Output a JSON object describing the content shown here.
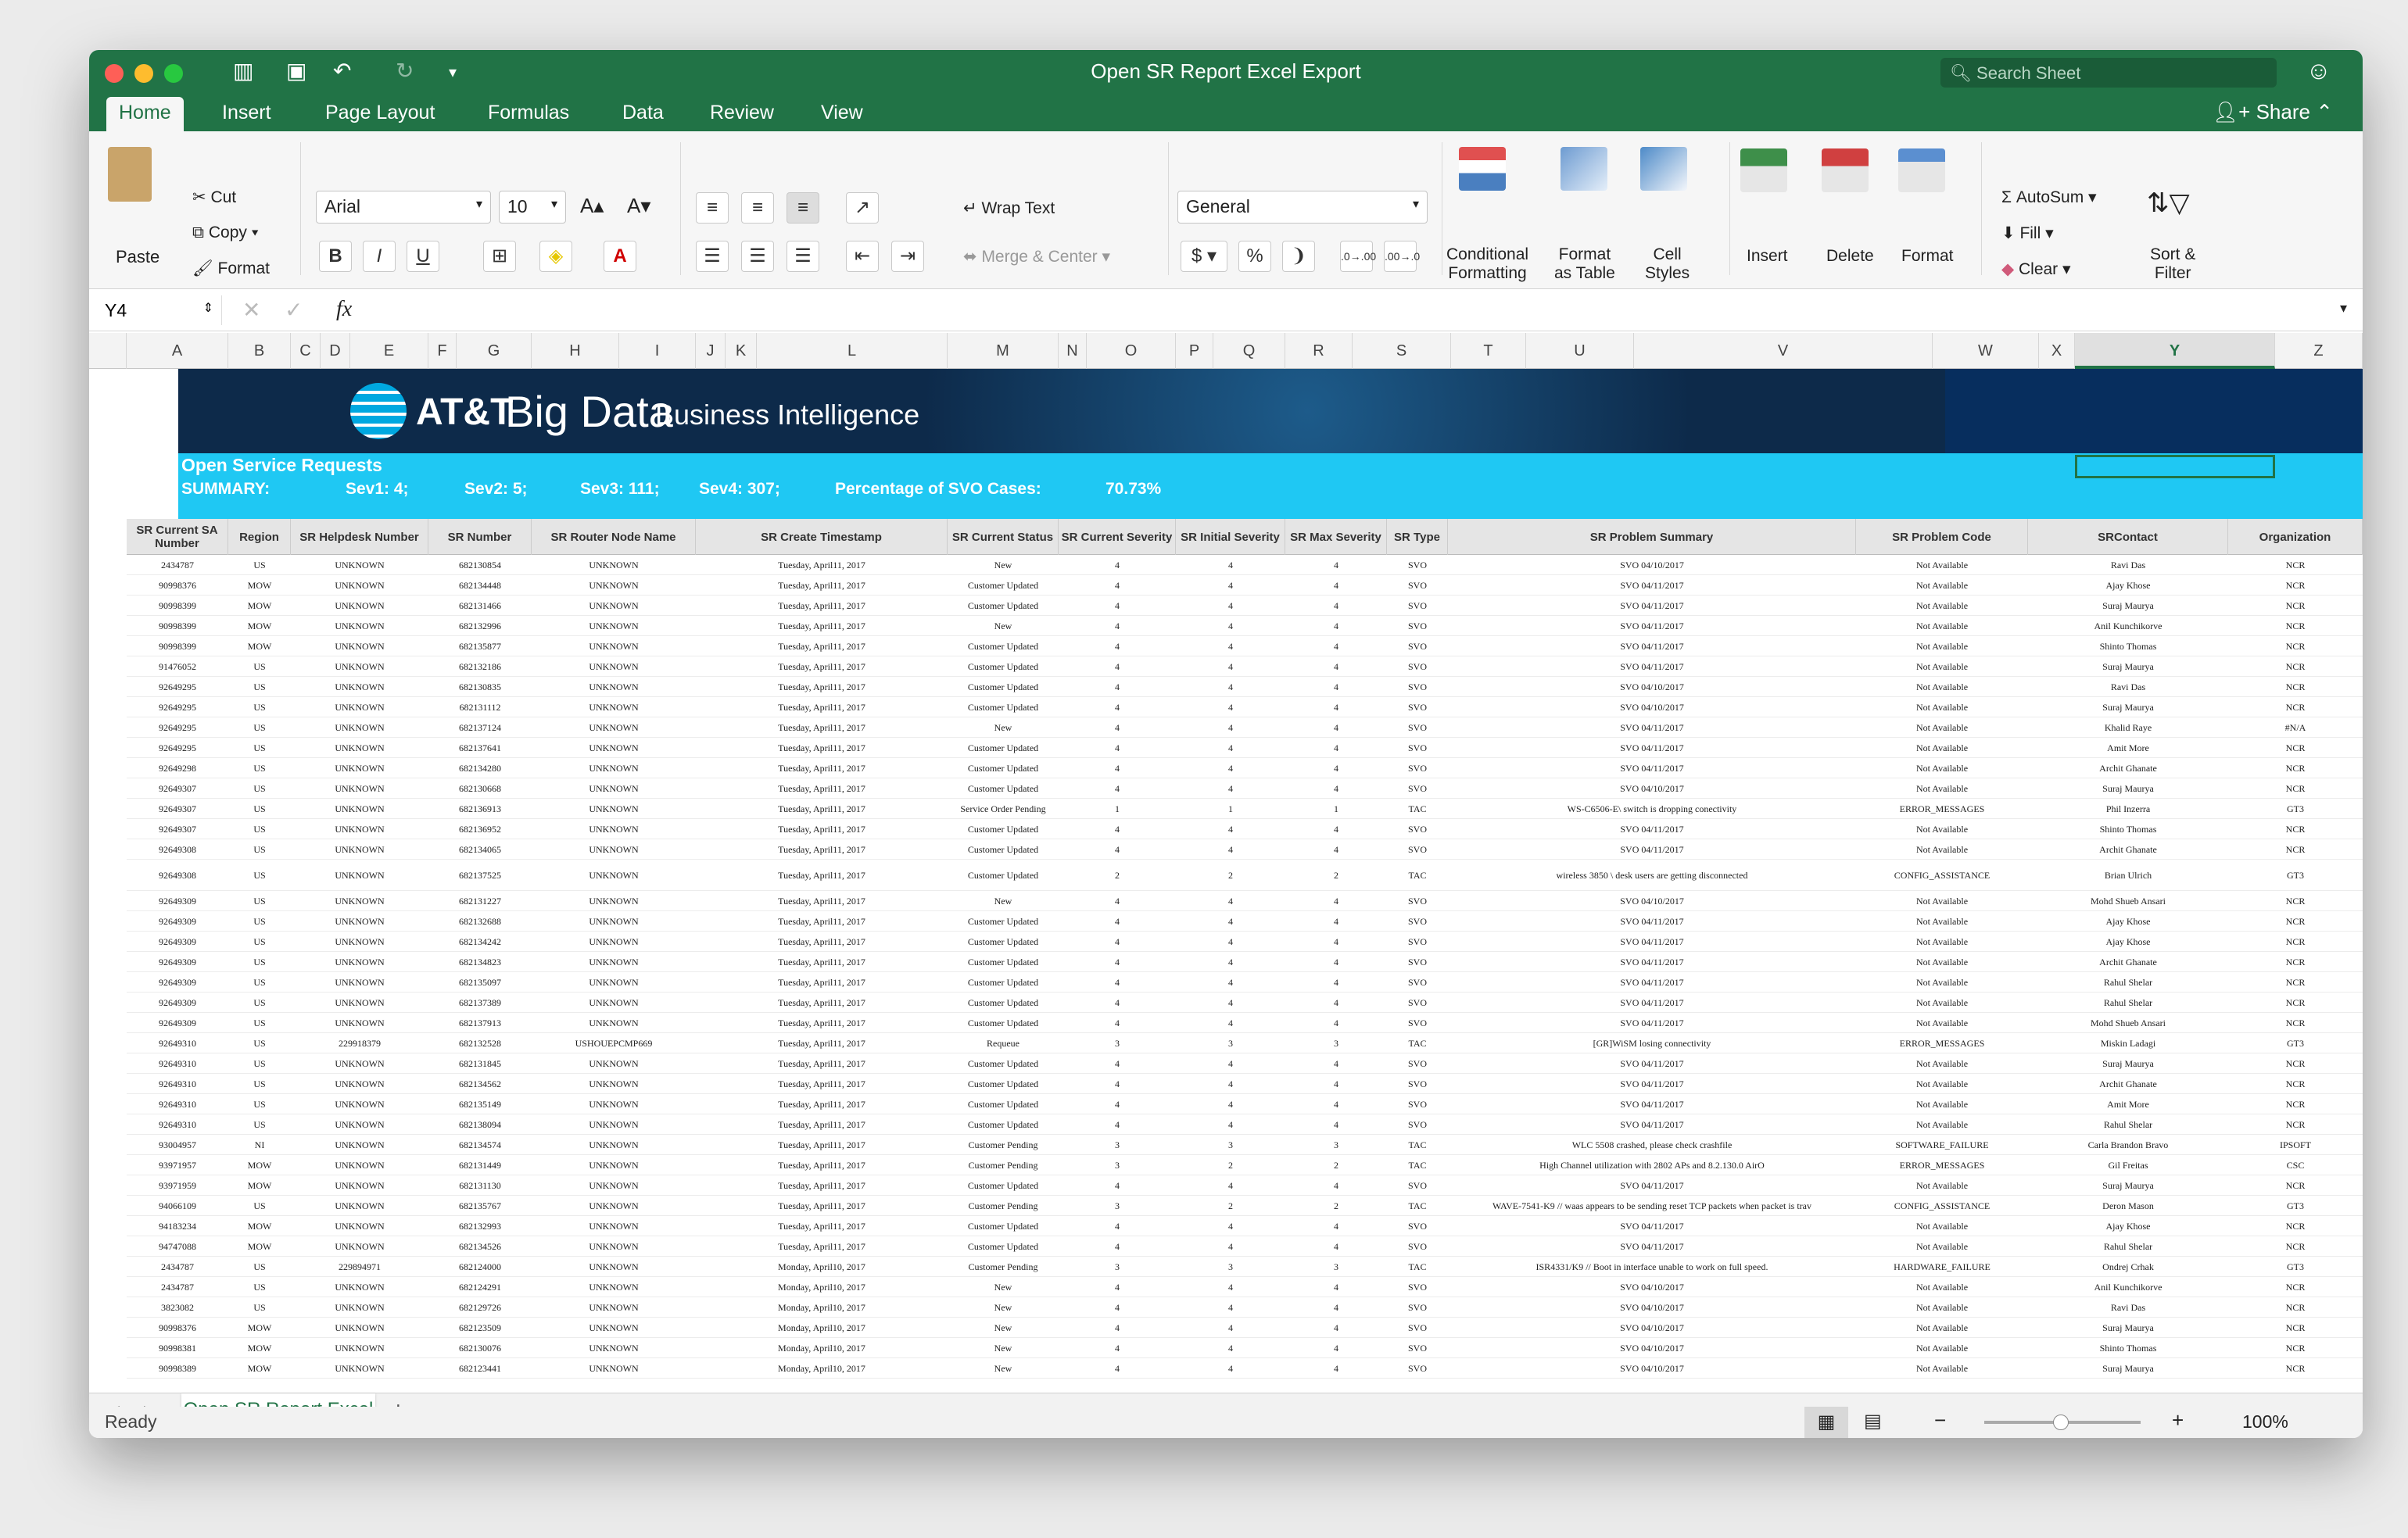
{
  "window": {
    "title": "Open SR Report Excel Export",
    "search_placeholder": "Search Sheet"
  },
  "tabs": [
    "Home",
    "Insert",
    "Page Layout",
    "Formulas",
    "Data",
    "Review",
    "View"
  ],
  "share_label": "Share",
  "ribbon": {
    "paste": "Paste",
    "cut": "Cut",
    "copy": "Copy",
    "format": "Format",
    "font": "Arial",
    "size": "10",
    "wrap": "Wrap Text",
    "merge": "Merge & Center",
    "number_format": "General",
    "conditional": "Conditional\nFormatting",
    "format_table": "Format\nas Table",
    "cell_styles": "Cell\nStyles",
    "insert": "Insert",
    "delete": "Delete",
    "format2": "Format",
    "autosum": "AutoSum",
    "fill": "Fill",
    "clear": "Clear",
    "sort": "Sort &\nFilter"
  },
  "formula": {
    "name_box": "Y4",
    "fx": "fx"
  },
  "columns": [
    "A",
    "B",
    "C",
    "D",
    "E",
    "F",
    "G",
    "H",
    "I",
    "J",
    "K",
    "L",
    "M",
    "N",
    "O",
    "P",
    "Q",
    "R",
    "S",
    "T",
    "U",
    "V",
    "W",
    "X",
    "Y",
    "Z"
  ],
  "banner": {
    "att": "AT&T",
    "big_data": "Big Data",
    "bi": "Business Intelligence"
  },
  "summary": {
    "title": "Open Service Requests",
    "label": "SUMMARY:",
    "sev1": "Sev1: 4;",
    "sev2": "Sev2: 5;",
    "sev3": "Sev3: 111;",
    "sev4": "Sev4: 307;",
    "svo_label": "Percentage of SVO Cases:",
    "svo_value": "70.73%"
  },
  "headers": [
    "SR Current SA Number",
    "Region",
    "SR Helpdesk Number",
    "SR Number",
    "SR Router Node Name",
    "SR Create Timestamp",
    "SR Current Status",
    "SR Current Severity",
    "SR Initial Severity",
    "SR Max Severity",
    "SR Type",
    "SR Problem Summary",
    "SR Problem Code",
    "SRContact",
    "Organization"
  ],
  "rows": [
    [
      "2434787",
      "US",
      "UNKNOWN",
      "682130854",
      "UNKNOWN",
      "Tuesday, April11, 2017",
      "New",
      "4",
      "4",
      "4",
      "SVO",
      "SVO 04/10/2017",
      "Not Available",
      "Ravi Das",
      "NCR"
    ],
    [
      "90998376",
      "MOW",
      "UNKNOWN",
      "682134448",
      "UNKNOWN",
      "Tuesday, April11, 2017",
      "Customer Updated",
      "4",
      "4",
      "4",
      "SVO",
      "SVO 04/11/2017",
      "Not Available",
      "Ajay Khose",
      "NCR"
    ],
    [
      "90998399",
      "MOW",
      "UNKNOWN",
      "682131466",
      "UNKNOWN",
      "Tuesday, April11, 2017",
      "Customer Updated",
      "4",
      "4",
      "4",
      "SVO",
      "SVO 04/11/2017",
      "Not Available",
      "Suraj Maurya",
      "NCR"
    ],
    [
      "90998399",
      "MOW",
      "UNKNOWN",
      "682132996",
      "UNKNOWN",
      "Tuesday, April11, 2017",
      "New",
      "4",
      "4",
      "4",
      "SVO",
      "SVO 04/11/2017",
      "Not Available",
      "Anil Kunchikorve",
      "NCR"
    ],
    [
      "90998399",
      "MOW",
      "UNKNOWN",
      "682135877",
      "UNKNOWN",
      "Tuesday, April11, 2017",
      "Customer Updated",
      "4",
      "4",
      "4",
      "SVO",
      "SVO 04/11/2017",
      "Not Available",
      "Shinto Thomas",
      "NCR"
    ],
    [
      "91476052",
      "US",
      "UNKNOWN",
      "682132186",
      "UNKNOWN",
      "Tuesday, April11, 2017",
      "Customer Updated",
      "4",
      "4",
      "4",
      "SVO",
      "SVO 04/11/2017",
      "Not Available",
      "Suraj Maurya",
      "NCR"
    ],
    [
      "92649295",
      "US",
      "UNKNOWN",
      "682130835",
      "UNKNOWN",
      "Tuesday, April11, 2017",
      "Customer Updated",
      "4",
      "4",
      "4",
      "SVO",
      "SVO 04/10/2017",
      "Not Available",
      "Ravi Das",
      "NCR"
    ],
    [
      "92649295",
      "US",
      "UNKNOWN",
      "682131112",
      "UNKNOWN",
      "Tuesday, April11, 2017",
      "Customer Updated",
      "4",
      "4",
      "4",
      "SVO",
      "SVO 04/10/2017",
      "Not Available",
      "Suraj Maurya",
      "NCR"
    ],
    [
      "92649295",
      "US",
      "UNKNOWN",
      "682137124",
      "UNKNOWN",
      "Tuesday, April11, 2017",
      "New",
      "4",
      "4",
      "4",
      "SVO",
      "SVO 04/11/2017",
      "Not Available",
      "Khalid Raye",
      "#N/A"
    ],
    [
      "92649295",
      "US",
      "UNKNOWN",
      "682137641",
      "UNKNOWN",
      "Tuesday, April11, 2017",
      "Customer Updated",
      "4",
      "4",
      "4",
      "SVO",
      "SVO 04/11/2017",
      "Not Available",
      "Amit More",
      "NCR"
    ],
    [
      "92649298",
      "US",
      "UNKNOWN",
      "682134280",
      "UNKNOWN",
      "Tuesday, April11, 2017",
      "Customer Updated",
      "4",
      "4",
      "4",
      "SVO",
      "SVO 04/11/2017",
      "Not Available",
      "Archit Ghanate",
      "NCR"
    ],
    [
      "92649307",
      "US",
      "UNKNOWN",
      "682130668",
      "UNKNOWN",
      "Tuesday, April11, 2017",
      "Customer Updated",
      "4",
      "4",
      "4",
      "SVO",
      "SVO 04/10/2017",
      "Not Available",
      "Suraj Maurya",
      "NCR"
    ],
    [
      "92649307",
      "US",
      "UNKNOWN",
      "682136913",
      "UNKNOWN",
      "Tuesday, April11, 2017",
      "Service Order Pending",
      "1",
      "1",
      "1",
      "TAC",
      "WS-C6506-E\\ switch is dropping conectivity",
      "ERROR_MESSAGES",
      "Phil Inzerra",
      "GT3"
    ],
    [
      "92649307",
      "US",
      "UNKNOWN",
      "682136952",
      "UNKNOWN",
      "Tuesday, April11, 2017",
      "Customer Updated",
      "4",
      "4",
      "4",
      "SVO",
      "SVO 04/11/2017",
      "Not Available",
      "Shinto Thomas",
      "NCR"
    ],
    [
      "92649308",
      "US",
      "UNKNOWN",
      "682134065",
      "UNKNOWN",
      "Tuesday, April11, 2017",
      "Customer Updated",
      "4",
      "4",
      "4",
      "SVO",
      "SVO 04/11/2017",
      "Not Available",
      "Archit Ghanate",
      "NCR"
    ],
    [
      "92649308",
      "US",
      "UNKNOWN",
      "682137525",
      "UNKNOWN",
      "Tuesday, April11, 2017",
      "Customer Updated",
      "2",
      "2",
      "2",
      "TAC",
      "wireless 3850 \\ desk users are getting disconnected",
      "CONFIG_ASSISTANCE",
      "Brian Ulrich",
      "GT3"
    ],
    [
      "92649309",
      "US",
      "UNKNOWN",
      "682131227",
      "UNKNOWN",
      "Tuesday, April11, 2017",
      "New",
      "4",
      "4",
      "4",
      "SVO",
      "SVO 04/10/2017",
      "Not Available",
      "Mohd Shueb Ansari",
      "NCR"
    ],
    [
      "92649309",
      "US",
      "UNKNOWN",
      "682132688",
      "UNKNOWN",
      "Tuesday, April11, 2017",
      "Customer Updated",
      "4",
      "4",
      "4",
      "SVO",
      "SVO 04/11/2017",
      "Not Available",
      "Ajay Khose",
      "NCR"
    ],
    [
      "92649309",
      "US",
      "UNKNOWN",
      "682134242",
      "UNKNOWN",
      "Tuesday, April11, 2017",
      "Customer Updated",
      "4",
      "4",
      "4",
      "SVO",
      "SVO 04/11/2017",
      "Not Available",
      "Ajay Khose",
      "NCR"
    ],
    [
      "92649309",
      "US",
      "UNKNOWN",
      "682134823",
      "UNKNOWN",
      "Tuesday, April11, 2017",
      "Customer Updated",
      "4",
      "4",
      "4",
      "SVO",
      "SVO 04/11/2017",
      "Not Available",
      "Archit Ghanate",
      "NCR"
    ],
    [
      "92649309",
      "US",
      "UNKNOWN",
      "682135097",
      "UNKNOWN",
      "Tuesday, April11, 2017",
      "Customer Updated",
      "4",
      "4",
      "4",
      "SVO",
      "SVO 04/11/2017",
      "Not Available",
      "Rahul Shelar",
      "NCR"
    ],
    [
      "92649309",
      "US",
      "UNKNOWN",
      "682137389",
      "UNKNOWN",
      "Tuesday, April11, 2017",
      "Customer Updated",
      "4",
      "4",
      "4",
      "SVO",
      "SVO 04/11/2017",
      "Not Available",
      "Rahul Shelar",
      "NCR"
    ],
    [
      "92649309",
      "US",
      "UNKNOWN",
      "682137913",
      "UNKNOWN",
      "Tuesday, April11, 2017",
      "Customer Updated",
      "4",
      "4",
      "4",
      "SVO",
      "SVO 04/11/2017",
      "Not Available",
      "Mohd Shueb Ansari",
      "NCR"
    ],
    [
      "92649310",
      "US",
      "229918379",
      "682132528",
      "USHOUEPCMP669",
      "Tuesday, April11, 2017",
      "Requeue",
      "3",
      "3",
      "3",
      "TAC",
      "[GR]WiSM losing connectivity",
      "ERROR_MESSAGES",
      "Miskin Ladagi",
      "GT3"
    ],
    [
      "92649310",
      "US",
      "UNKNOWN",
      "682131845",
      "UNKNOWN",
      "Tuesday, April11, 2017",
      "Customer Updated",
      "4",
      "4",
      "4",
      "SVO",
      "SVO 04/11/2017",
      "Not Available",
      "Suraj Maurya",
      "NCR"
    ],
    [
      "92649310",
      "US",
      "UNKNOWN",
      "682134562",
      "UNKNOWN",
      "Tuesday, April11, 2017",
      "Customer Updated",
      "4",
      "4",
      "4",
      "SVO",
      "SVO 04/11/2017",
      "Not Available",
      "Archit Ghanate",
      "NCR"
    ],
    [
      "92649310",
      "US",
      "UNKNOWN",
      "682135149",
      "UNKNOWN",
      "Tuesday, April11, 2017",
      "Customer Updated",
      "4",
      "4",
      "4",
      "SVO",
      "SVO 04/11/2017",
      "Not Available",
      "Amit More",
      "NCR"
    ],
    [
      "92649310",
      "US",
      "UNKNOWN",
      "682138094",
      "UNKNOWN",
      "Tuesday, April11, 2017",
      "Customer Updated",
      "4",
      "4",
      "4",
      "SVO",
      "SVO 04/11/2017",
      "Not Available",
      "Rahul Shelar",
      "NCR"
    ],
    [
      "93004957",
      "NI",
      "UNKNOWN",
      "682134574",
      "UNKNOWN",
      "Tuesday, April11, 2017",
      "Customer Pending",
      "3",
      "3",
      "3",
      "TAC",
      "WLC 5508 crashed, please check crashfile",
      "SOFTWARE_FAILURE",
      "Carla Brandon Bravo",
      "IPSOFT"
    ],
    [
      "93971957",
      "MOW",
      "UNKNOWN",
      "682131449",
      "UNKNOWN",
      "Tuesday, April11, 2017",
      "Customer Pending",
      "3",
      "2",
      "2",
      "TAC",
      "High Channel utilization with 2802 APs and 8.2.130.0 AirO",
      "ERROR_MESSAGES",
      "Gil Freitas",
      "CSC"
    ],
    [
      "93971959",
      "MOW",
      "UNKNOWN",
      "682131130",
      "UNKNOWN",
      "Tuesday, April11, 2017",
      "Customer Updated",
      "4",
      "4",
      "4",
      "SVO",
      "SVO 04/11/2017",
      "Not Available",
      "Suraj Maurya",
      "NCR"
    ],
    [
      "94066109",
      "US",
      "UNKNOWN",
      "682135767",
      "UNKNOWN",
      "Tuesday, April11, 2017",
      "Customer Pending",
      "3",
      "2",
      "2",
      "TAC",
      "WAVE-7541-K9 // waas appears to be sending reset TCP packets when packet is trav",
      "CONFIG_ASSISTANCE",
      "Deron Mason",
      "GT3"
    ],
    [
      "94183234",
      "MOW",
      "UNKNOWN",
      "682132993",
      "UNKNOWN",
      "Tuesday, April11, 2017",
      "Customer Updated",
      "4",
      "4",
      "4",
      "SVO",
      "SVO 04/11/2017",
      "Not Available",
      "Ajay Khose",
      "NCR"
    ],
    [
      "94747088",
      "MOW",
      "UNKNOWN",
      "682134526",
      "UNKNOWN",
      "Tuesday, April11, 2017",
      "Customer Updated",
      "4",
      "4",
      "4",
      "SVO",
      "SVO 04/11/2017",
      "Not Available",
      "Rahul Shelar",
      "NCR"
    ],
    [
      "2434787",
      "US",
      "229894971",
      "682124000",
      "UNKNOWN",
      "Monday, April10, 2017",
      "Customer Pending",
      "3",
      "3",
      "3",
      "TAC",
      "ISR4331/K9 // Boot in interface unable to work on full speed.",
      "HARDWARE_FAILURE",
      "Ondrej Crhak",
      "GT3"
    ],
    [
      "2434787",
      "US",
      "UNKNOWN",
      "682124291",
      "UNKNOWN",
      "Monday, April10, 2017",
      "New",
      "4",
      "4",
      "4",
      "SVO",
      "SVO 04/10/2017",
      "Not Available",
      "Anil Kunchikorve",
      "NCR"
    ],
    [
      "3823082",
      "US",
      "UNKNOWN",
      "682129726",
      "UNKNOWN",
      "Monday, April10, 2017",
      "New",
      "4",
      "4",
      "4",
      "SVO",
      "SVO 04/10/2017",
      "Not Available",
      "Ravi Das",
      "NCR"
    ],
    [
      "90998376",
      "MOW",
      "UNKNOWN",
      "682123509",
      "UNKNOWN",
      "Monday, April10, 2017",
      "New",
      "4",
      "4",
      "4",
      "SVO",
      "SVO 04/10/2017",
      "Not Available",
      "Suraj Maurya",
      "NCR"
    ],
    [
      "90998381",
      "MOW",
      "UNKNOWN",
      "682130076",
      "UNKNOWN",
      "Monday, April10, 2017",
      "New",
      "4",
      "4",
      "4",
      "SVO",
      "SVO 04/10/2017",
      "Not Available",
      "Shinto Thomas",
      "NCR"
    ],
    [
      "90998389",
      "MOW",
      "UNKNOWN",
      "682123441",
      "UNKNOWN",
      "Monday, April10, 2017",
      "New",
      "4",
      "4",
      "4",
      "SVO",
      "SVO 04/10/2017",
      "Not Available",
      "Suraj Maurya",
      "NCR"
    ]
  ],
  "sheet_tab": "Open SR Report Excel Export",
  "status": {
    "ready": "Ready",
    "zoom": "100%"
  }
}
